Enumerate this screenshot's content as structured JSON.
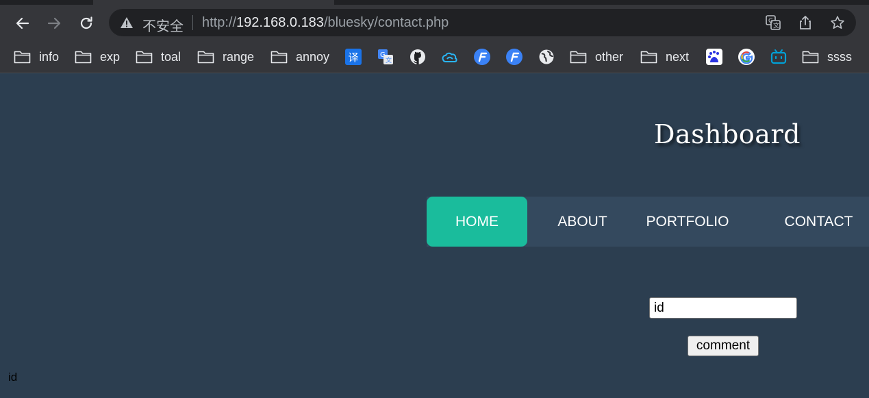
{
  "browser": {
    "security_label": "不安全",
    "url_scheme": "http://",
    "url_host": "192.168.0.183",
    "url_path": "/bluesky/contact.php",
    "icons": [
      "back-icon",
      "forward-icon",
      "reload-icon",
      "warning-icon",
      "translate-icon",
      "share-icon",
      "star-icon"
    ]
  },
  "bookmarks": {
    "folders": [
      "info",
      "exp",
      "toal",
      "range",
      "annoy",
      "other",
      "next",
      "ssss"
    ],
    "translate_glyph": "译"
  },
  "page": {
    "title": "Dashboard",
    "menu": [
      "HOME",
      "ABOUT",
      "PORTFOLIO",
      "CONTACT"
    ],
    "active_menu": "HOME",
    "id_input_value": "id",
    "comment_button": "comment",
    "output_text": "id",
    "colors": {
      "background": "#2c3e50",
      "menu_bar": "#34495e",
      "active_menu": "#1abc9c"
    }
  }
}
